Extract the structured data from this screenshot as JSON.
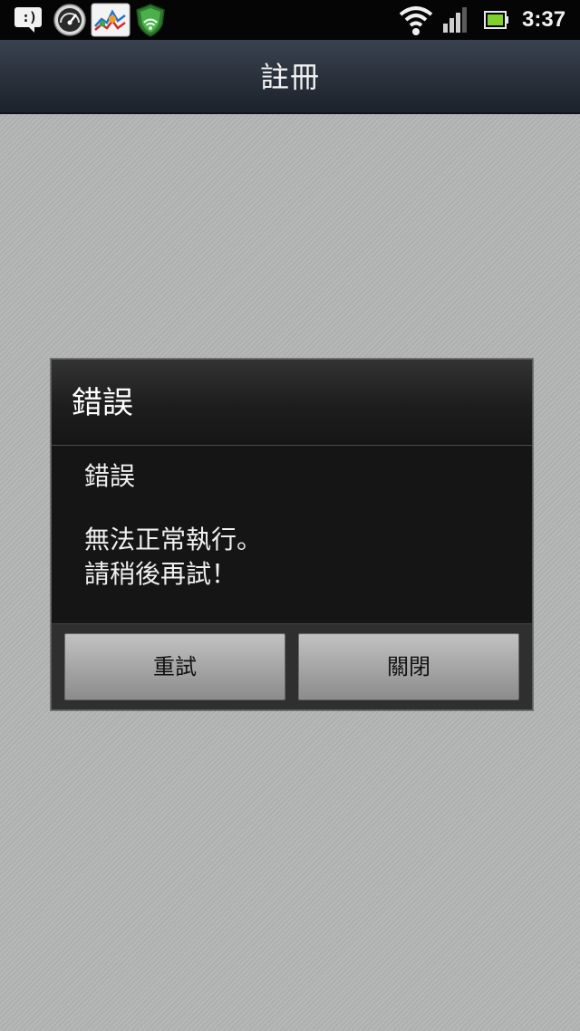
{
  "status_bar": {
    "time": "3:37",
    "icons": [
      "message-smile-icon",
      "speedometer-icon",
      "chart-app-icon",
      "shield-icon",
      "wifi-icon",
      "signal-icon",
      "battery-icon"
    ],
    "message_icon_text": ":)"
  },
  "title_bar": {
    "title": "註冊"
  },
  "dialog": {
    "title": "錯誤",
    "message": {
      "line1": "錯誤",
      "line2": "無法正常執行。",
      "line3": "請稍後再試！"
    },
    "buttons": {
      "retry": "重試",
      "close": "關閉"
    }
  },
  "colors": {
    "background": "#b3b4b4",
    "status_bar": "#050505",
    "title_bar": "#2b323d",
    "dialog_bg": "#171717",
    "button": "#a6a6a6"
  }
}
